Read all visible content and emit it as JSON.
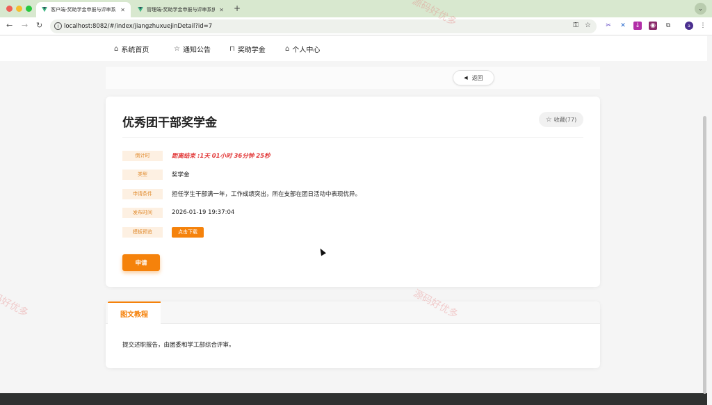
{
  "browser": {
    "tabs": [
      {
        "title": "客户端-奖助学金申报与评审系统",
        "active": true
      },
      {
        "title": "管理端-奖助学金申报与评审系统",
        "active": false
      }
    ],
    "url": "localhost:8082/#/index/jiangzhuxuejinDetail?id=7",
    "profile_initial": "a"
  },
  "nav": {
    "items": [
      {
        "label": "系统首页",
        "icon": "home-icon"
      },
      {
        "label": "通知公告",
        "icon": "star-icon"
      },
      {
        "label": "奖助学金",
        "icon": "bag-icon"
      },
      {
        "label": "个人中心",
        "icon": "home-icon"
      }
    ]
  },
  "back": {
    "label": "返回"
  },
  "detail": {
    "title": "优秀团干部奖学金",
    "favorite": "收藏(77)",
    "rows": [
      {
        "label": "倒计时",
        "value": "距离结束 :1天 01小时 36分钟 25秒"
      },
      {
        "label": "类型",
        "value": "奖学金"
      },
      {
        "label": "申请条件",
        "value": "担任学生干部满一年，工作成绩突出，所在支部在团日活动中表现优异。"
      },
      {
        "label": "发布时间",
        "value": "2026-01-19 19:37:04"
      },
      {
        "label": "模板预览",
        "value": "点击下载"
      }
    ],
    "apply_label": "申请"
  },
  "tutorial": {
    "tab_label": "图文教程",
    "content": "提交述职报告，由团委和学工部综合评审。"
  },
  "watermark": "源码好优多",
  "colors": {
    "accent": "#f5820b",
    "countdown": "#e23b3b",
    "label_bg": "#fdf0e2"
  }
}
